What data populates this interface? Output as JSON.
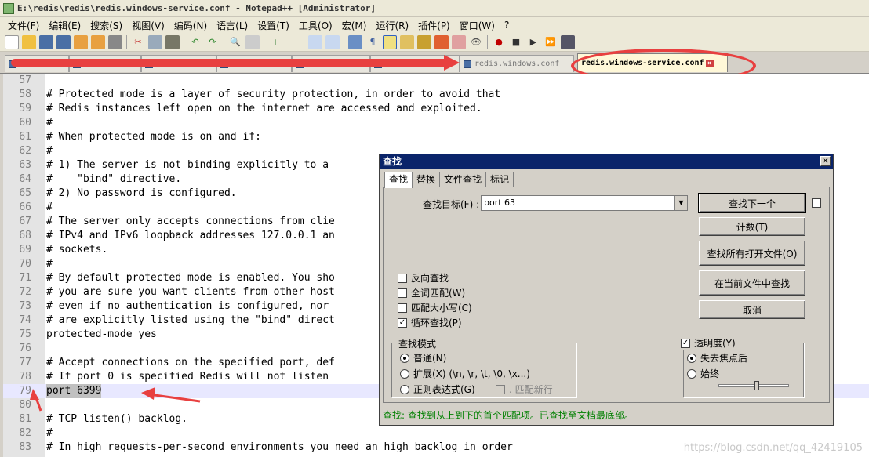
{
  "window": {
    "title": "E:\\redis\\redis\\redis.windows-service.conf - Notepad++ [Administrator]"
  },
  "menu": [
    "文件(F)",
    "编辑(E)",
    "搜索(S)",
    "视图(V)",
    "编码(N)",
    "语言(L)",
    "设置(T)",
    "工具(O)",
    "宏(M)",
    "运行(R)",
    "插件(P)",
    "窗口(W)",
    "?"
  ],
  "tabs": {
    "inactive_label": "redis.windows.conf",
    "active_label": "redis.windows-service.conf"
  },
  "editor": {
    "lines": [
      {
        "n": "57",
        "text": ""
      },
      {
        "n": "58",
        "text": "# Protected mode is a layer of security protection, in order to avoid that"
      },
      {
        "n": "59",
        "text": "# Redis instances left open on the internet are accessed and exploited."
      },
      {
        "n": "60",
        "text": "#"
      },
      {
        "n": "61",
        "text": "# When protected mode is on and if:"
      },
      {
        "n": "62",
        "text": "#"
      },
      {
        "n": "63",
        "text": "# 1) The server is not binding explicitly to a"
      },
      {
        "n": "64",
        "text": "#    \"bind\" directive."
      },
      {
        "n": "65",
        "text": "# 2) No password is configured."
      },
      {
        "n": "66",
        "text": "#"
      },
      {
        "n": "67",
        "text": "# The server only accepts connections from clie"
      },
      {
        "n": "68",
        "text": "# IPv4 and IPv6 loopback addresses 127.0.0.1 an"
      },
      {
        "n": "69",
        "text": "# sockets."
      },
      {
        "n": "70",
        "text": "#"
      },
      {
        "n": "71",
        "text": "# By default protected mode is enabled. You sho"
      },
      {
        "n": "72",
        "text": "# you are sure you want clients from other host"
      },
      {
        "n": "73",
        "text": "# even if no authentication is configured, nor"
      },
      {
        "n": "74",
        "text": "# are explicitly listed using the \"bind\" direct"
      },
      {
        "n": "75",
        "text": "protected-mode yes"
      },
      {
        "n": "76",
        "text": ""
      },
      {
        "n": "77",
        "text": "# Accept connections on the specified port, def"
      },
      {
        "n": "78",
        "text": "# If port 0 is specified Redis will not listen"
      },
      {
        "n": "79",
        "text": "port 6399"
      },
      {
        "n": "80",
        "text": ""
      },
      {
        "n": "81",
        "text": "# TCP listen() backlog."
      },
      {
        "n": "82",
        "text": "#"
      },
      {
        "n": "83",
        "text": "# In high requests-per-second environments you need an high backlog in order"
      }
    ]
  },
  "find_dialog": {
    "title": "查找",
    "close_glyph": "×",
    "tabs": [
      "查找",
      "替换",
      "文件查找",
      "标记"
    ],
    "find_label": "查找目标(F) :",
    "find_value": "port 63",
    "buttons": {
      "find_next": "查找下一个",
      "count": "计数(T)",
      "find_all_open": "查找所有打开文件(O)",
      "find_all_current": "在当前文件中查找",
      "cancel": "取消"
    },
    "options": {
      "backward": "反向查找",
      "whole_word": "全词匹配(W)",
      "match_case": "匹配大小写(C)",
      "wrap": "循环查找(P)"
    },
    "search_mode": {
      "title": "查找模式",
      "normal": "普通(N)",
      "extended": "扩展(X) (\\n, \\r, \\t, \\0, \\x...)",
      "regex": "正则表达式(G)",
      "dot_newline": ". 匹配新行"
    },
    "transparency": {
      "title": "透明度(Y)",
      "on_lose_focus": "失去焦点后",
      "always": "始终",
      "level": 0.55
    },
    "status": "查找: 查找到从上到下的首个匹配项。已查找至文档最底部。"
  },
  "watermark": "https://blog.csdn.net/qq_42419105",
  "colors": {
    "annotation": "#e84040",
    "status_green": "#008000",
    "title_blue": "#0a246a"
  }
}
